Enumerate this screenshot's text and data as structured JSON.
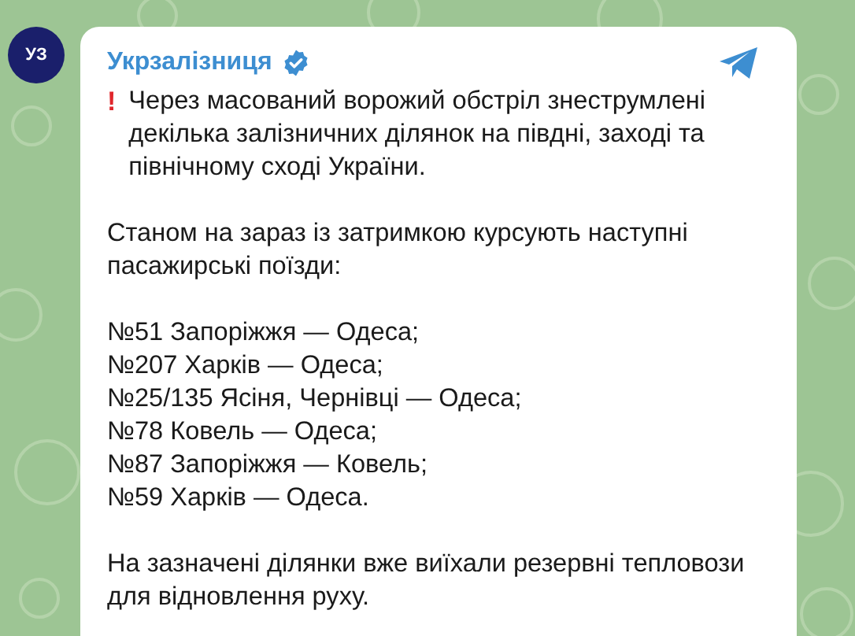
{
  "channel": {
    "name": "Укрзалізниця",
    "verified": true,
    "avatar_text": "УЗ"
  },
  "message": {
    "alert_mark": "!",
    "paragraphs": [
      {
        "kind": "text",
        "lines": [
          "Через масований ворожий обстріл знеструмлені",
          "декілька залізничних ділянок на півдні, заході та",
          "північному сході України."
        ]
      },
      {
        "kind": "text",
        "lines": [
          "Станом на зараз із затримкою курсують наступні",
          "пасажирські поїзди:"
        ]
      },
      {
        "kind": "list",
        "lines": [
          "№51 Запоріжжя — Одеса;",
          "№207 Харків — Одеса;",
          "№25/135 Ясіня, Чернівці — Одеса;",
          "№78 Ковель — Одеса;",
          "№87 Запоріжжя — Ковель;",
          "№59 Харків — Одеса."
        ]
      },
      {
        "kind": "text",
        "lines": [
          "На зазначені ділянки вже виїхали резервні тепловози",
          "для відновлення руху."
        ]
      }
    ]
  }
}
